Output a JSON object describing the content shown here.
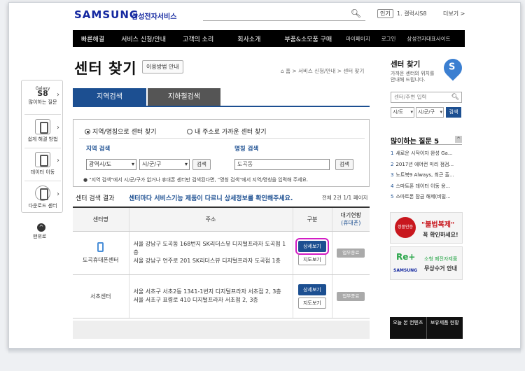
{
  "header": {
    "logo": "SAMSUNG",
    "logo_sub": "삼성전자서비스",
    "popular_tag": "인기",
    "popular_text": "1. 갤럭시S8",
    "more": "더보기 >"
  },
  "gnb": {
    "items": [
      "빠른해결",
      "서비스 신청/안내",
      "고객의 소리",
      "회사소개",
      "부품&소모품 구매",
      "마이페이지",
      "로그인",
      "삼성전자대표사이트"
    ]
  },
  "quick_menu": {
    "galaxy_small": "Galaxy",
    "galaxy_big": "S8",
    "faq": "많이하는 질문",
    "easy_fix": "쉽게 해결 방법",
    "data_move": "데이터 이동",
    "download": "다운로드 센터",
    "top_arrow": "^",
    "top_label": "맨위로"
  },
  "main": {
    "title": "센터 찾기",
    "howto_btn": "이용방법 안내",
    "breadcrumb": "⌂ 홈 > 서비스 신청/안내 > 센터 찾기",
    "tab_region": "지역검색",
    "tab_subway": "지하철검색",
    "radio_region": "지역/명칭으로 센터 찾기",
    "radio_near": "내 주소로 가까운 센터 찾기",
    "region_label": "지역 검색",
    "name_label": "명칭 검색",
    "sel_city": "광역시/도",
    "sel_district": "시/군/구",
    "search_btn": "검색",
    "name_input": "도곡동",
    "note": "\"지역 검색\"에서 시/군/구가 없거나 휴대폰 센터만 검색된다면, \"명칭 검색\"에서 지역/명칭을 입력해 주세요.",
    "result_title": "센터 검색 결과",
    "result_link": "센터마다 서비스기능 제품이 다르니 상세정보를 확인해주세요.",
    "result_count": "전체 2건 1/1 페이지"
  },
  "table": {
    "headers": [
      "센터명",
      "주소",
      "구분",
      "대기현황",
      "(휴대폰)"
    ],
    "rows": [
      {
        "name": "도곡휴대폰센터",
        "addr1": "서울 강남구 도곡동 168번지 SK리더스뷰 디지털프라자 도곡점 1층",
        "addr2": "서울 강남구 언주로 201 SK리더스뷰 디지털프라자 도곡점 1층",
        "detail": "상세보기",
        "map": "지도보기",
        "wait": "업무종료"
      },
      {
        "name": "서초센터",
        "addr1": "서울 서초구 서초2동 1341-1번지 디지털프라자 서초점 2, 3층",
        "addr2": "서울 서초구 표령로 410 디지털프라자 서초점 2, 3층",
        "detail": "상세보기",
        "map": "지도보기",
        "wait": "업무종료"
      }
    ]
  },
  "right": {
    "title": "센터 찾기",
    "desc1": "가까운 센터의 위치를",
    "desc2": "안내해 드립니다.",
    "pin": "S",
    "input_placeholder": "센터/주변 입력",
    "sel_city": "시/도",
    "sel_district": "시/군/구",
    "search_btn": "검색",
    "faq_title": "많이하는 질문 5",
    "faq_toggle": "^",
    "faq": [
      {
        "num": "1",
        "text": "새로운 시작이자 완성 Ga..."
      },
      {
        "num": "2",
        "text": "2017년 에어컨 미리 점검..."
      },
      {
        "num": "3",
        "text": "노트북9 Always, 최근 출..."
      },
      {
        "num": "4",
        "text": "스마트폰 데이터 이동 용..."
      },
      {
        "num": "5",
        "text": "스마트폰 잠금 해제(비밀..."
      }
    ],
    "banner1_badge": "정품인증",
    "banner1_t1": "\"불법복제\"",
    "banner1_t2": "꼭 확인하세요!",
    "banner2_re": "Re+",
    "banner2_brand": "SAMSUNG",
    "banner2_t1": "소형 폐전자제품",
    "banner2_t2": "무상수거 안내",
    "black_left": "오늘 본 컨텐츠",
    "black_right": "보유제품 현황"
  }
}
